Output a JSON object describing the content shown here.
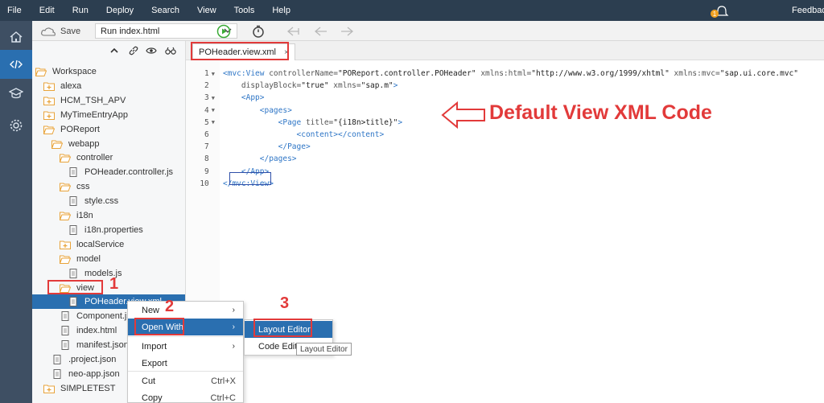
{
  "menu": {
    "items": [
      "File",
      "Edit",
      "Run",
      "Deploy",
      "Search",
      "View",
      "Tools",
      "Help"
    ],
    "feedback": "Feedbac",
    "notification_count": "1"
  },
  "toolbar": {
    "save_label": "Save",
    "run_config": "Run index.html"
  },
  "activity_icons": [
    "home-icon",
    "code-icon",
    "learning-icon",
    "settings-icon"
  ],
  "explorer": {
    "tree": [
      {
        "label": "Workspace",
        "icon": "folder-open",
        "depth": 0
      },
      {
        "label": "alexa",
        "icon": "folder-plus",
        "depth": 1
      },
      {
        "label": "HCM_TSH_APV",
        "icon": "folder-plus",
        "depth": 1
      },
      {
        "label": "MyTimeEntryApp",
        "icon": "folder-plus",
        "depth": 1
      },
      {
        "label": "POReport",
        "icon": "folder-open",
        "depth": 1
      },
      {
        "label": "webapp",
        "icon": "folder-open",
        "depth": 2
      },
      {
        "label": "controller",
        "icon": "folder-open",
        "depth": 3
      },
      {
        "label": "POHeader.controller.js",
        "icon": "file",
        "depth": 4
      },
      {
        "label": "css",
        "icon": "folder-open",
        "depth": 3
      },
      {
        "label": "style.css",
        "icon": "file",
        "depth": 4
      },
      {
        "label": "i18n",
        "icon": "folder-open",
        "depth": 3
      },
      {
        "label": "i18n.properties",
        "icon": "file",
        "depth": 4
      },
      {
        "label": "localService",
        "icon": "folder-plus",
        "depth": 3
      },
      {
        "label": "model",
        "icon": "folder-open",
        "depth": 3
      },
      {
        "label": "models.js",
        "icon": "file",
        "depth": 4
      },
      {
        "label": "view",
        "icon": "folder-open",
        "depth": 3
      },
      {
        "label": "POHeader.view.xml",
        "icon": "file",
        "depth": 4,
        "selected": true
      },
      {
        "label": "Component.js",
        "icon": "file",
        "depth": 3
      },
      {
        "label": "index.html",
        "icon": "file",
        "depth": 3
      },
      {
        "label": "manifest.json",
        "icon": "file",
        "depth": 3
      },
      {
        "label": ".project.json",
        "icon": "file",
        "depth": 2
      },
      {
        "label": "neo-app.json",
        "icon": "file",
        "depth": 2
      },
      {
        "label": "SIMPLETEST",
        "icon": "folder-plus",
        "depth": 1
      }
    ]
  },
  "editor": {
    "tab_label": "POHeader.view.xml",
    "tab_close": "×",
    "lines": [
      {
        "n": "1",
        "fold": true,
        "parts": [
          [
            "tag",
            "<mvc:View "
          ],
          [
            "attr",
            "controllerName="
          ],
          [
            "str",
            "\"POReport.controller.POHeader\" "
          ],
          [
            "attr",
            "xmlns:html="
          ],
          [
            "str",
            "\"http://www.w3.org/1999/xhtml\" "
          ],
          [
            "attr",
            "xmlns:mvc="
          ],
          [
            "str",
            "\"sap.ui.core.mvc\""
          ]
        ]
      },
      {
        "n": "2",
        "fold": false,
        "parts": [
          [
            "attr",
            "    displayBlock="
          ],
          [
            "str",
            "\"true\" "
          ],
          [
            "attr",
            "xmlns="
          ],
          [
            "str",
            "\"sap.m\""
          ],
          [
            "tag",
            ">"
          ]
        ]
      },
      {
        "n": "3",
        "fold": true,
        "parts": [
          [
            "tag",
            "    <App>"
          ]
        ]
      },
      {
        "n": "4",
        "fold": true,
        "parts": [
          [
            "tag",
            "        <pages>"
          ]
        ]
      },
      {
        "n": "5",
        "fold": true,
        "parts": [
          [
            "tag",
            "            <Page "
          ],
          [
            "attr",
            "title="
          ],
          [
            "str",
            "\"{i18n>title}\""
          ],
          [
            "tag",
            ">"
          ]
        ]
      },
      {
        "n": "6",
        "fold": false,
        "parts": [
          [
            "tag",
            "                <content></content>"
          ]
        ]
      },
      {
        "n": "7",
        "fold": false,
        "parts": [
          [
            "tag",
            "            </Page>"
          ]
        ]
      },
      {
        "n": "8",
        "fold": false,
        "parts": [
          [
            "tag",
            "        </pages>"
          ]
        ]
      },
      {
        "n": "9",
        "fold": false,
        "parts": [
          [
            "tag",
            "    </App>"
          ]
        ]
      },
      {
        "n": "10",
        "fold": false,
        "parts": [
          [
            "tag",
            "</mvc:View>"
          ]
        ]
      }
    ]
  },
  "annotations": {
    "title": "Default View XML Code",
    "step1": "1",
    "step2": "2",
    "step3": "3",
    "color": "#e23a3a"
  },
  "context_menu": {
    "items": [
      {
        "label": "New",
        "submenu": true,
        "shortcut": ""
      },
      {
        "label": "Open With",
        "submenu": true,
        "shortcut": "",
        "highlighted": true
      },
      {
        "label": "Import",
        "submenu": true,
        "shortcut": ""
      },
      {
        "label": "Export",
        "submenu": false,
        "shortcut": ""
      },
      {
        "label": "Cut",
        "submenu": false,
        "shortcut": "Ctrl+X"
      },
      {
        "label": "Copy",
        "submenu": false,
        "shortcut": "Ctrl+C"
      }
    ],
    "submenu": [
      {
        "label": "Layout Editor",
        "highlighted": true
      },
      {
        "label": "Code Editor"
      }
    ],
    "tooltip": "Layout Editor"
  },
  "colors": {
    "menubar": "#2c3e50",
    "activitybar": "#3e4f63",
    "accent": "#2a6fb0",
    "folder": "#e8a33a"
  }
}
